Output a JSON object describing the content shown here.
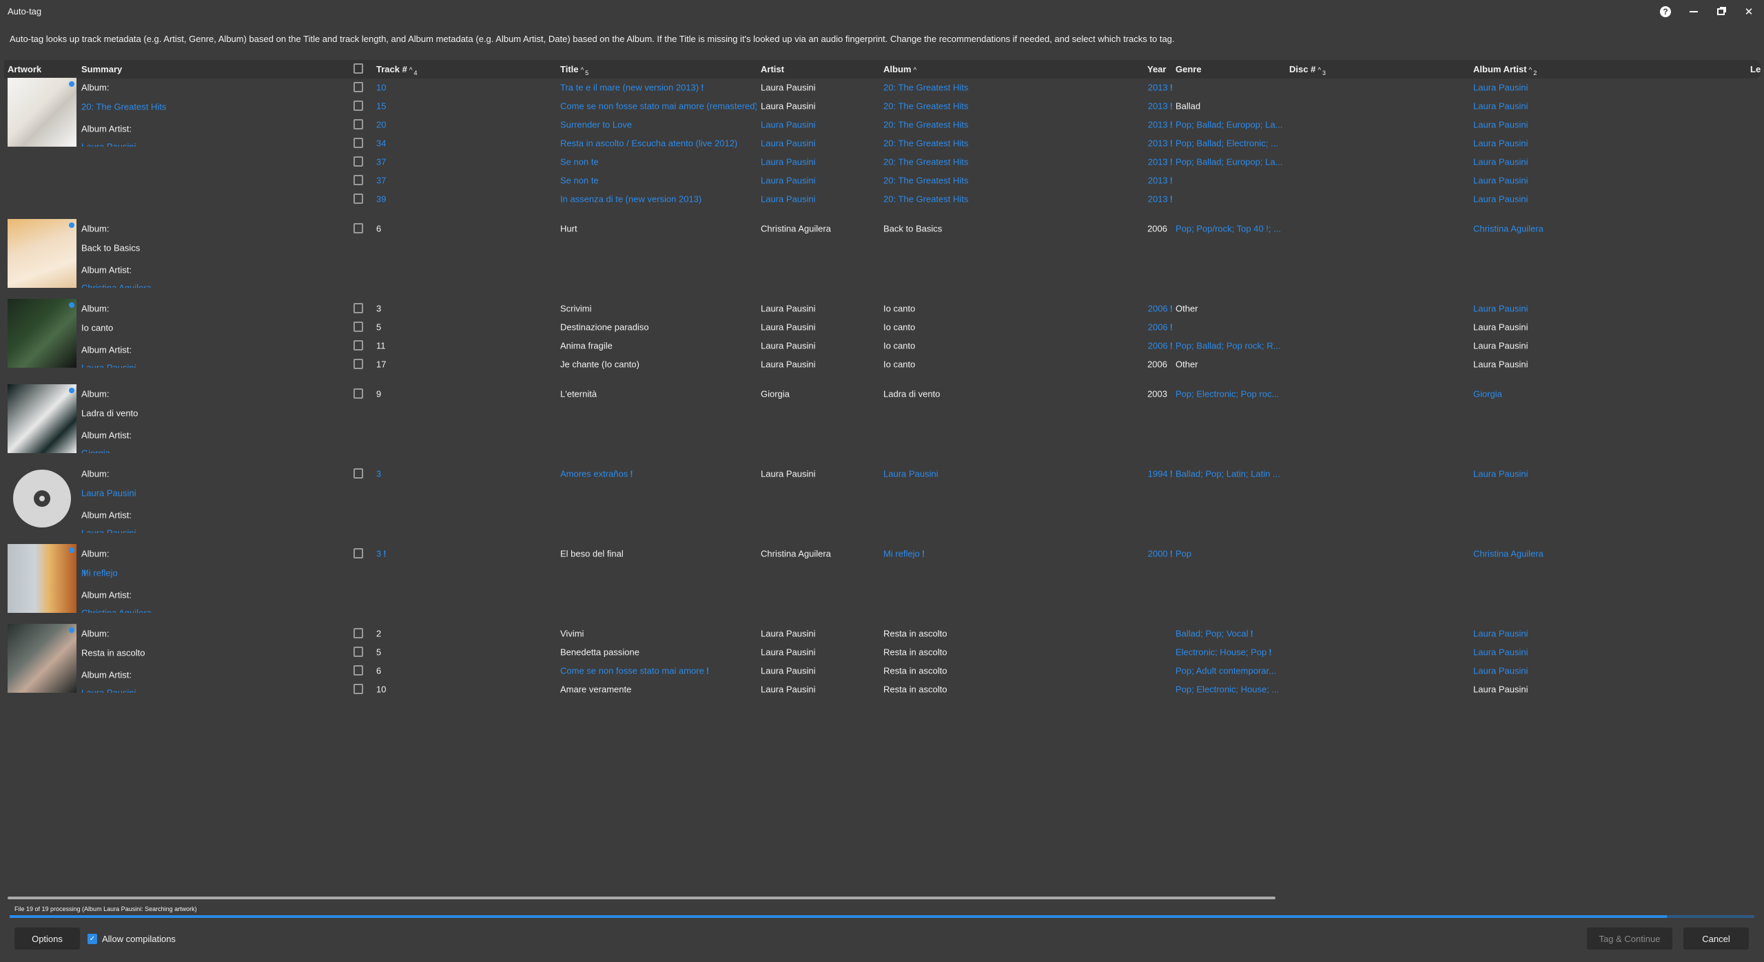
{
  "window": {
    "title": "Auto-tag",
    "help_icon": "help-icon",
    "minimize_icon": "minimize-icon",
    "restore_icon": "restore-icon",
    "close_icon": "close-icon"
  },
  "description": "Auto-tag looks up track metadata (e.g. Artist, Genre, Album) based on the Title and track length, and Album metadata (e.g. Album Artist, Date) based on the Album. If the Title is missing it's looked up via an audio fingerprint. Change the recommendations if needed, and select which tracks to tag.",
  "columns": {
    "artwork": "Artwork",
    "summary": "Summary",
    "track": "Track #",
    "track_sort": "4",
    "title": "Title",
    "title_sort": "5",
    "artist": "Artist",
    "album": "Album",
    "year": "Year",
    "genre": "Genre",
    "disc": "Disc #",
    "disc_sort": "3",
    "album_artist": "Album Artist",
    "album_artist_sort": "2",
    "length": "Le",
    "sort_arrow": "^"
  },
  "summary_labels": {
    "album": "Album:",
    "album_artist": "Album Artist:"
  },
  "colors": {
    "background": "#3c3c3c",
    "header": "#333333",
    "accent": "#2d8ae8"
  },
  "groups": [
    {
      "art": "greatest-hits",
      "album": [
        "20: The Greatest Hits",
        "b"
      ],
      "album_artist": [
        "Laura Pausini",
        "b"
      ],
      "rows": [
        {
          "track": [
            "10",
            "b"
          ],
          "title": [
            "Tra te e il mare (new version 2013)",
            "bw"
          ],
          "artist": [
            "Laura Pausini",
            ""
          ],
          "album": [
            "20: The Greatest Hits",
            "b"
          ],
          "year": [
            "2013",
            "bw"
          ],
          "genre": [
            "",
            ""
          ],
          "album_artist": [
            "Laura Pausini",
            "b"
          ]
        },
        {
          "track": [
            "15",
            "b"
          ],
          "title": [
            "Come se non fosse stato mai amore (remastered)",
            "b"
          ],
          "artist": [
            "Laura Pausini",
            ""
          ],
          "album": [
            "20: The Greatest Hits",
            "b"
          ],
          "year": [
            "2013",
            "bw"
          ],
          "genre": [
            "Ballad",
            ""
          ],
          "album_artist": [
            "Laura Pausini",
            "b"
          ]
        },
        {
          "track": [
            "20",
            "b"
          ],
          "title": [
            "Surrender to Love",
            "b"
          ],
          "artist": [
            "Laura Pausini",
            "b"
          ],
          "album": [
            "20: The Greatest Hits",
            "b"
          ],
          "year": [
            "2013",
            "bw"
          ],
          "genre": [
            "Pop; Ballad; Europop; La...",
            "b"
          ],
          "album_artist": [
            "Laura Pausini",
            "b"
          ]
        },
        {
          "track": [
            "34",
            "b"
          ],
          "title": [
            "Resta in ascolto / Escucha atento (live 2012)",
            "b"
          ],
          "artist": [
            "Laura Pausini",
            "b"
          ],
          "album": [
            "20: The Greatest Hits",
            "b"
          ],
          "year": [
            "2013",
            "bw"
          ],
          "genre": [
            "Pop; Ballad; Electronic; ...",
            "b"
          ],
          "album_artist": [
            "Laura Pausini",
            "b"
          ]
        },
        {
          "track": [
            "37",
            "b"
          ],
          "title": [
            "Se non te",
            "b"
          ],
          "artist": [
            "Laura Pausini",
            "b"
          ],
          "album": [
            "20: The Greatest Hits",
            "b"
          ],
          "year": [
            "2013",
            "bw"
          ],
          "genre": [
            "Pop; Ballad; Europop; La...",
            "b"
          ],
          "album_artist": [
            "Laura Pausini",
            "b"
          ]
        },
        {
          "track": [
            "37",
            "b"
          ],
          "title": [
            "Se non te",
            "b"
          ],
          "artist": [
            "Laura Pausini",
            "b"
          ],
          "album": [
            "20: The Greatest Hits",
            "b"
          ],
          "year": [
            "2013",
            "bw"
          ],
          "genre": [
            "",
            ""
          ],
          "album_artist": [
            "Laura Pausini",
            "b"
          ]
        },
        {
          "track": [
            "39",
            "b"
          ],
          "title": [
            "In assenza di te (new version 2013)",
            "b"
          ],
          "artist": [
            "Laura Pausini",
            "b"
          ],
          "album": [
            "20: The Greatest Hits",
            "b"
          ],
          "year": [
            "2013",
            "bw"
          ],
          "genre": [
            "",
            ""
          ],
          "album_artist": [
            "Laura Pausini",
            "b"
          ]
        }
      ]
    },
    {
      "art": "back-to-basics",
      "album": [
        "Back to Basics",
        ""
      ],
      "album_artist": [
        "Christina Aguilera",
        "b"
      ],
      "rows": [
        {
          "track": [
            "6",
            ""
          ],
          "title": [
            "Hurt",
            ""
          ],
          "artist": [
            "Christina Aguilera",
            ""
          ],
          "album": [
            "Back to Basics",
            ""
          ],
          "year": [
            "2006",
            ""
          ],
          "genre": [
            "Pop; Pop/rock; Top 40 !; ...",
            "b"
          ],
          "album_artist": [
            "Christina Aguilera",
            "b"
          ]
        }
      ]
    },
    {
      "art": "io-canto",
      "album": [
        "Io canto",
        ""
      ],
      "album_artist": [
        "Laura Pausini",
        "b"
      ],
      "rows": [
        {
          "track": [
            "3",
            ""
          ],
          "title": [
            "Scrivimi",
            ""
          ],
          "artist": [
            "Laura Pausini",
            ""
          ],
          "album": [
            "Io canto",
            ""
          ],
          "year": [
            "2006",
            "bw"
          ],
          "genre": [
            "Other",
            ""
          ],
          "album_artist": [
            "Laura Pausini",
            "b"
          ]
        },
        {
          "track": [
            "5",
            ""
          ],
          "title": [
            "Destinazione paradiso",
            ""
          ],
          "artist": [
            "Laura Pausini",
            ""
          ],
          "album": [
            "Io canto",
            ""
          ],
          "year": [
            "2006",
            "bw"
          ],
          "genre": [
            "",
            ""
          ],
          "album_artist": [
            "Laura Pausini",
            ""
          ]
        },
        {
          "track": [
            "11",
            ""
          ],
          "title": [
            "Anima fragile",
            ""
          ],
          "artist": [
            "Laura Pausini",
            ""
          ],
          "album": [
            "Io canto",
            ""
          ],
          "year": [
            "2006",
            "bw"
          ],
          "genre": [
            "Pop; Ballad; Pop rock; R...",
            "b"
          ],
          "album_artist": [
            "Laura Pausini",
            ""
          ]
        },
        {
          "track": [
            "17",
            ""
          ],
          "title": [
            "Je chante (Io canto)",
            ""
          ],
          "artist": [
            "Laura Pausini",
            ""
          ],
          "album": [
            "Io canto",
            ""
          ],
          "year": [
            "2006",
            ""
          ],
          "genre": [
            "Other",
            ""
          ],
          "album_artist": [
            "Laura Pausini",
            ""
          ]
        }
      ]
    },
    {
      "art": "ladra-di-vento",
      "album": [
        "Ladra di vento",
        ""
      ],
      "album_artist": [
        "Giorgia",
        "b"
      ],
      "rows": [
        {
          "track": [
            "9",
            ""
          ],
          "title": [
            "L'eternità",
            ""
          ],
          "artist": [
            "Giorgia",
            ""
          ],
          "album": [
            "Ladra di vento",
            ""
          ],
          "year": [
            "2003",
            ""
          ],
          "genre": [
            "Pop; Electronic; Pop roc...",
            "b"
          ],
          "album_artist": [
            "Giorgia",
            "b"
          ]
        }
      ]
    },
    {
      "art": "disc",
      "album": [
        "Laura Pausini",
        "b"
      ],
      "album_artist": [
        "Laura Pausini",
        "b"
      ],
      "rows": [
        {
          "track": [
            "3",
            "b"
          ],
          "title": [
            "Amores extraños",
            "bw"
          ],
          "artist": [
            "Laura Pausini",
            ""
          ],
          "album": [
            "Laura Pausini",
            "b"
          ],
          "year": [
            "1994",
            "bw"
          ],
          "genre": [
            "Ballad; Pop; Latin; Latin ...",
            "b"
          ],
          "album_artist": [
            "Laura Pausini",
            "b"
          ]
        }
      ]
    },
    {
      "art": "mi-reflejo",
      "album": [
        "Mi reflejo",
        "bw"
      ],
      "album_artist": [
        "Christina Aguilera",
        "b"
      ],
      "rows": [
        {
          "track": [
            "3",
            "bw"
          ],
          "title": [
            "El beso del final",
            ""
          ],
          "artist": [
            "Christina Aguilera",
            ""
          ],
          "album": [
            "Mi reflejo",
            "bw"
          ],
          "year": [
            "2000",
            "bw"
          ],
          "genre": [
            "Pop",
            "b"
          ],
          "album_artist": [
            "Christina Aguilera",
            "b"
          ]
        }
      ]
    },
    {
      "art": "resta-in-ascolto",
      "album": [
        "Resta in ascolto",
        ""
      ],
      "album_artist": [
        "Laura Pausini",
        "b"
      ],
      "rows": [
        {
          "track": [
            "2",
            ""
          ],
          "title": [
            "Vivimi",
            ""
          ],
          "artist": [
            "Laura Pausini",
            ""
          ],
          "album": [
            "Resta in ascolto",
            ""
          ],
          "year": [
            "",
            ""
          ],
          "genre": [
            "Ballad; Pop; Vocal",
            "bw"
          ],
          "album_artist": [
            "Laura Pausini",
            "b"
          ]
        },
        {
          "track": [
            "5",
            ""
          ],
          "title": [
            "Benedetta passione",
            ""
          ],
          "artist": [
            "Laura Pausini",
            ""
          ],
          "album": [
            "Resta in ascolto",
            ""
          ],
          "year": [
            "",
            ""
          ],
          "genre": [
            "Electronic; House; Pop",
            "bw"
          ],
          "album_artist": [
            "Laura Pausini",
            "b"
          ]
        },
        {
          "track": [
            "6",
            ""
          ],
          "title": [
            "Come se non fosse stato mai amore",
            "bw"
          ],
          "artist": [
            "Laura Pausini",
            ""
          ],
          "album": [
            "Resta in ascolto",
            ""
          ],
          "year": [
            "",
            ""
          ],
          "genre": [
            "Pop; Adult contemporar...",
            "b"
          ],
          "album_artist": [
            "Laura Pausini",
            "b"
          ]
        },
        {
          "track": [
            "10",
            ""
          ],
          "title": [
            "Amare veramente",
            ""
          ],
          "artist": [
            "Laura Pausini",
            ""
          ],
          "album": [
            "Resta in ascolto",
            ""
          ],
          "year": [
            "",
            ""
          ],
          "genre": [
            "Pop; Electronic; House; ...",
            "b"
          ],
          "album_artist": [
            "Laura Pausini",
            ""
          ]
        }
      ]
    }
  ],
  "footer": {
    "status": "File 19 of 19 processing (Album Laura Pausini: Searching artwork)",
    "progress": 0.95,
    "options": "Options",
    "allow_compilations": "Allow compilations",
    "allow_compilations_checked": true,
    "tag_continue": "Tag & Continue",
    "cancel": "Cancel"
  }
}
